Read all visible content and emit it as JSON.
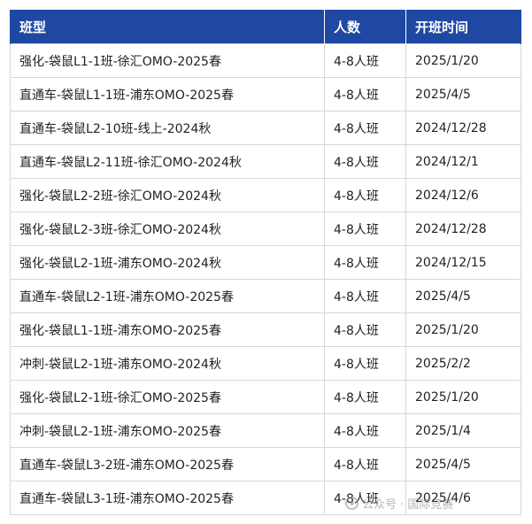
{
  "table": {
    "headers": [
      "班型",
      "人数",
      "开班时间"
    ],
    "rows": [
      [
        "强化-袋鼠L1-1班-徐汇OMO-2025春",
        "4-8人班",
        "2025/1/20"
      ],
      [
        "直通车-袋鼠L1-1班-浦东OMO-2025春",
        "4-8人班",
        "2025/4/5"
      ],
      [
        "直通车-袋鼠L2-10班-线上-2024秋",
        "4-8人班",
        "2024/12/28"
      ],
      [
        "直通车-袋鼠L2-11班-徐汇OMO-2024秋",
        "4-8人班",
        "2024/12/1"
      ],
      [
        "强化-袋鼠L2-2班-徐汇OMO-2024秋",
        "4-8人班",
        "2024/12/6"
      ],
      [
        "强化-袋鼠L2-3班-徐汇OMO-2024秋",
        "4-8人班",
        "2024/12/28"
      ],
      [
        "强化-袋鼠L2-1班-浦东OMO-2024秋",
        "4-8人班",
        "2024/12/15"
      ],
      [
        "直通车-袋鼠L2-1班-浦东OMO-2025春",
        "4-8人班",
        "2025/4/5"
      ],
      [
        "强化-袋鼠L1-1班-浦东OMO-2025春",
        "4-8人班",
        "2025/1/20"
      ],
      [
        "冲刺-袋鼠L2-1班-浦东OMO-2024秋",
        "4-8人班",
        "2025/2/2"
      ],
      [
        "强化-袋鼠L2-1班-徐汇OMO-2025春",
        "4-8人班",
        "2025/1/20"
      ],
      [
        "冲刺-袋鼠L2-1班-浦东OMO-2025春",
        "4-8人班",
        "2025/1/4"
      ],
      [
        "直通车-袋鼠L3-2班-浦东OMO-2025春",
        "4-8人班",
        "2025/4/5"
      ],
      [
        "直通车-袋鼠L3-1班-浦东OMO-2025春",
        "4-8人班",
        "2025/4/6"
      ]
    ]
  },
  "watermark": {
    "text": "公众号 · 国际竞赛"
  },
  "colors": {
    "header_bg": "#1f48a3",
    "header_text": "#ffffff",
    "border": "#d7d7d7"
  }
}
